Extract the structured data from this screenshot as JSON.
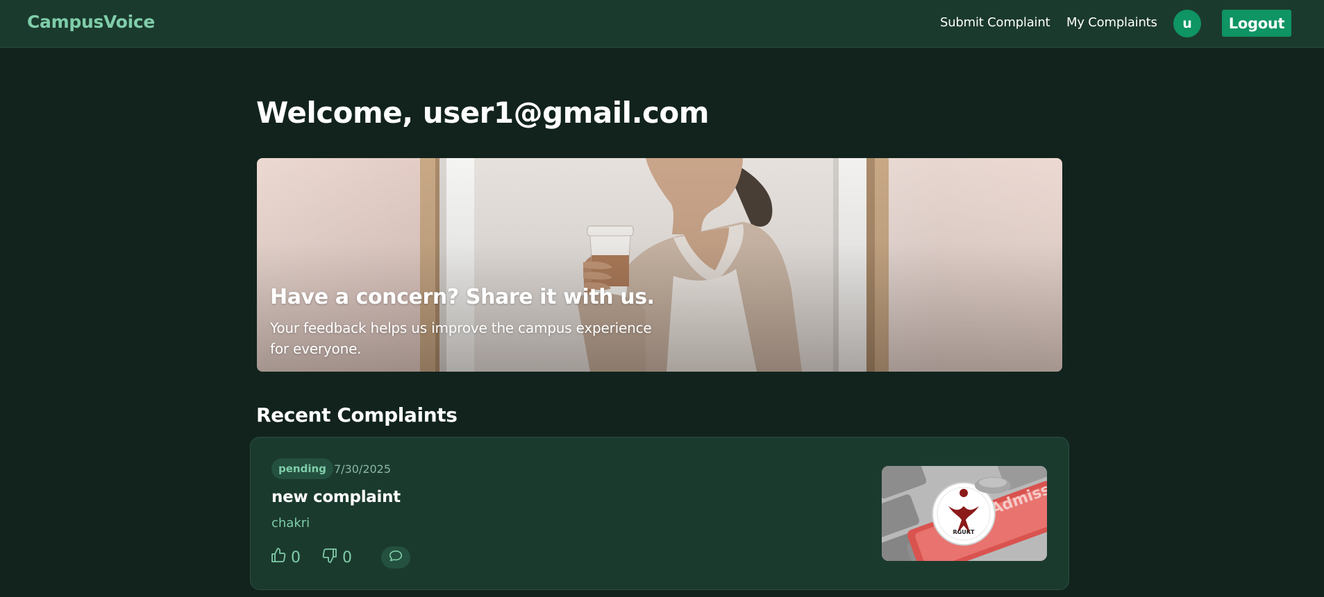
{
  "header": {
    "brand": "CampusVoice",
    "nav": [
      {
        "label": "Submit Complaint"
      },
      {
        "label": "My Complaints"
      }
    ],
    "avatar_initial": "u",
    "logout_label": "Logout"
  },
  "page": {
    "welcome": "Welcome, user1@gmail.com"
  },
  "hero": {
    "title": "Have a concern? Share it with us.",
    "subtitle": "Your feedback helps us improve the campus experience for everyone."
  },
  "recent": {
    "title": "Recent Complaints",
    "items": [
      {
        "status": "pending",
        "date": "7/30/2025",
        "title": "new complaint",
        "author": "chakri",
        "upvotes": "0",
        "downvotes": "0",
        "thumbnail_logo_text": "RGUKT",
        "thumbnail_bg_text": "Admission"
      }
    ]
  },
  "colors": {
    "background": "#12231e",
    "navbar": "#1b3a2e",
    "accent": "#0f9464",
    "brand_text": "#7fcda9",
    "card": "#1b3a2e"
  },
  "icons": [
    "thumbs-up-icon",
    "thumbs-down-icon",
    "comment-icon"
  ]
}
